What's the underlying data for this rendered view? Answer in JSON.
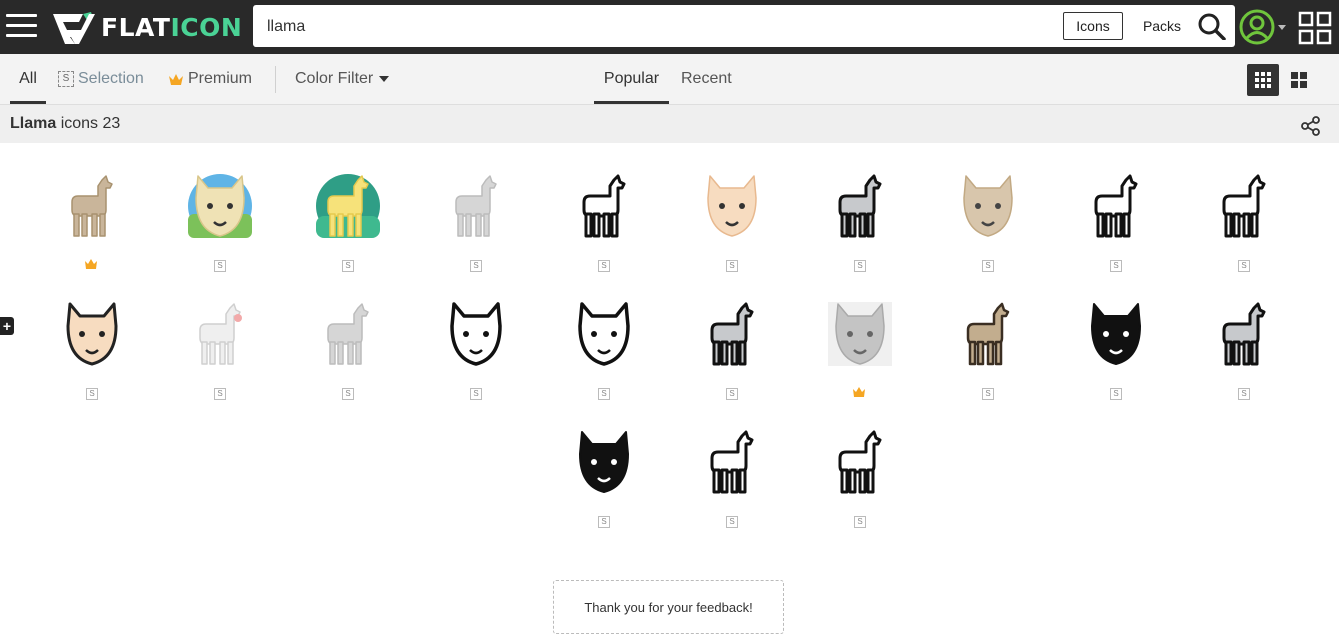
{
  "header": {
    "logo_flat": "FLAT",
    "logo_icon": "ICON",
    "search_value": "llama",
    "icons_label": "Icons",
    "packs_label": "Packs"
  },
  "filters": {
    "all": "All",
    "selection_badge": "S",
    "selection": "Selection",
    "premium": "Premium",
    "color_filter": "Color Filter",
    "popular": "Popular",
    "recent": "Recent"
  },
  "title": {
    "term": "Llama",
    "rest": "icons 23"
  },
  "results": [
    {
      "name": "llama-icon",
      "badge": "premium",
      "style": "flat-brown"
    },
    {
      "name": "llama-face-circle-icon",
      "badge": "free",
      "style": "circle-sky"
    },
    {
      "name": "llama-yellow-circle-icon",
      "badge": "free",
      "style": "circle-teal"
    },
    {
      "name": "llama-grey-icon",
      "badge": "free",
      "style": "flat-lightgrey"
    },
    {
      "name": "llama-outline-icon",
      "badge": "free",
      "style": "outline-black"
    },
    {
      "name": "alpaca-face-icon",
      "badge": "free",
      "style": "face-peach"
    },
    {
      "name": "llama-grey-outline-icon",
      "badge": "free",
      "style": "lineal-grey"
    },
    {
      "name": "yak-face-icon",
      "badge": "free",
      "style": "face-beige"
    },
    {
      "name": "llama-line-icon",
      "badge": "free",
      "style": "outline-black"
    },
    {
      "name": "llama-line-icon",
      "badge": "free",
      "style": "outline-black"
    },
    {
      "name": "alpaca-face-outline-icon",
      "badge": "free",
      "style": "face-peach-outline"
    },
    {
      "name": "alpaca-white-icon",
      "badge": "free",
      "style": "flat-white"
    },
    {
      "name": "llama-standing-icon",
      "badge": "free",
      "style": "flat-lightgrey"
    },
    {
      "name": "yak-outline-icon",
      "badge": "free",
      "style": "face-outline"
    },
    {
      "name": "llama-face-outline-icon",
      "badge": "free",
      "style": "face-outline"
    },
    {
      "name": "alpaca-grey-outline-icon",
      "badge": "free",
      "style": "lineal-grey"
    },
    {
      "name": "llama-face-grey-icon",
      "badge": "premium",
      "style": "face-grey"
    },
    {
      "name": "llama-brown-outline-icon",
      "badge": "free",
      "style": "lineal-brown"
    },
    {
      "name": "yak-face-solid-icon",
      "badge": "free",
      "style": "face-solid"
    },
    {
      "name": "llama-grey-lineal-icon",
      "badge": "free",
      "style": "lineal-grey"
    },
    {
      "name": "yak-solid-icon",
      "badge": "free",
      "style": "face-solid"
    },
    {
      "name": "alpaca-outline-icon",
      "badge": "free",
      "style": "outline-black"
    },
    {
      "name": "llama-woolly-outline-icon",
      "badge": "free",
      "style": "outline-black"
    }
  ],
  "free_badge_text": "S",
  "plus_label": "+",
  "feedback_text": "Thank you for your feedback!",
  "colors": {
    "topbar": "#292929",
    "brand_green": "#4ad295",
    "premium_gold": "#f5a623"
  }
}
